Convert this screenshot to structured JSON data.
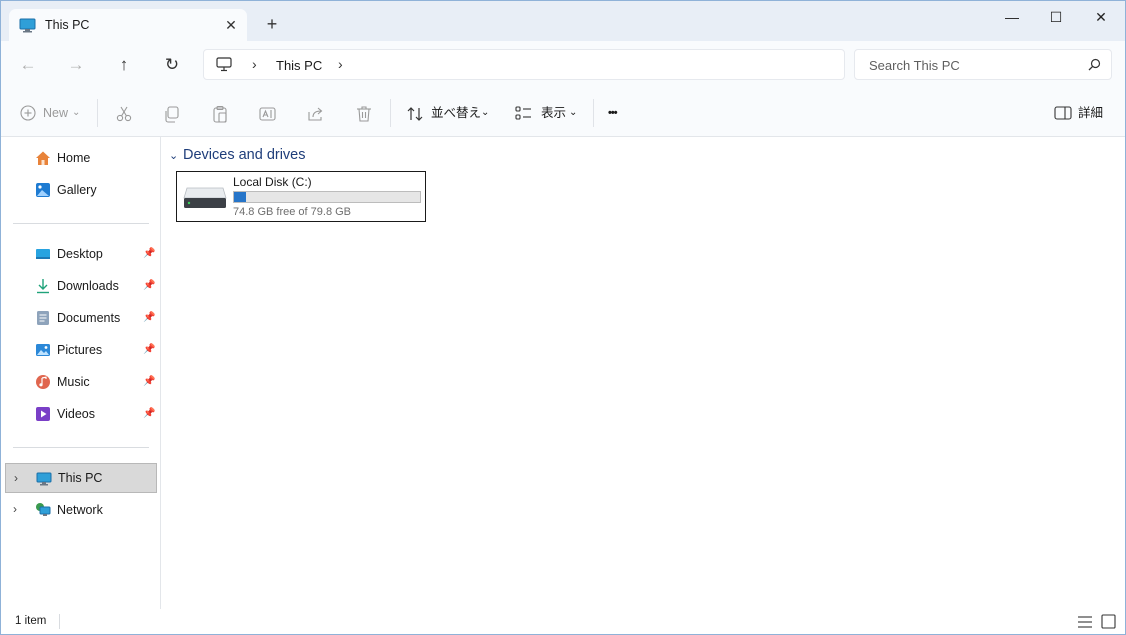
{
  "window": {
    "tab_title": "This PC",
    "tab_close": "✕",
    "new_tab": "+",
    "minimize": "—",
    "maximize": "☐",
    "close": "✕"
  },
  "nav": {
    "back": "←",
    "forward": "→",
    "up": "↑",
    "refresh": "↻",
    "breadcrumb_sep": "›",
    "breadcrumb": [
      "This PC"
    ]
  },
  "search": {
    "placeholder": "Search This PC"
  },
  "toolbar": {
    "new_label": "New",
    "sort_label": "並べ替え",
    "view_label": "表示",
    "more_label": "•••",
    "details_label": "詳細",
    "dropdown_caret": "⌄"
  },
  "sidebar": {
    "quick": [
      {
        "label": "Home"
      },
      {
        "label": "Gallery"
      }
    ],
    "pinned": [
      {
        "label": "Desktop"
      },
      {
        "label": "Downloads"
      },
      {
        "label": "Documents"
      },
      {
        "label": "Pictures"
      },
      {
        "label": "Music"
      },
      {
        "label": "Videos"
      }
    ],
    "pin_glyph": "📌",
    "chevron": "›",
    "devices": [
      {
        "label": "This PC",
        "selected": true
      },
      {
        "label": "Network",
        "selected": false
      }
    ]
  },
  "content": {
    "group_title": "Devices and drives",
    "group_chevron": "⌄",
    "drives": [
      {
        "name": "Local Disk (C:)",
        "free_text": "74.8 GB free of 79.8 GB",
        "used_fraction": 0.063
      }
    ]
  },
  "status": {
    "count": "1 item"
  },
  "colors": {
    "accent": "#2675c9",
    "group_title": "#1e3d7a",
    "title_bar": "#e8eef6"
  }
}
